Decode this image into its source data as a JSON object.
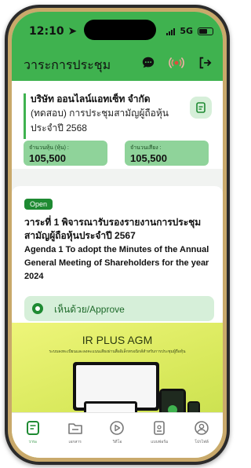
{
  "status_bar": {
    "time": "12:10",
    "network": "5G"
  },
  "header": {
    "title": "วาระการประชุม"
  },
  "company": {
    "name": "บริษัท ออนไลน์แอทเซ็ท จำกัด",
    "meeting": "(ทดสอบ) การประชุมสามัญผู้ถือหุ้นประจำปี 2568",
    "shares_label": "จำนวนหุ้น (หุ้น) :",
    "shares_value": "105,500",
    "votes_label": "จำนวนเสียง :",
    "votes_value": "105,500"
  },
  "agenda": {
    "status": "Open",
    "title_th": "วาระที่ 1 พิจารณารับรองรายงานการประชุมสามัญผู้ถือหุ้นประจำปี 2567",
    "title_en": "Agenda 1 To adopt the Minutes of the Annual General Meeting of Shareholders for the year 2024",
    "vote_option": "เห็นด้วย/Approve"
  },
  "promo": {
    "title": "IR PLUS AGM",
    "subtitle": "ระบบลงทะเบียนและลงคะแนนเสียงผ่านสื่ออิเล็กทรอนิกส์สำหรับการประชุมผู้ถือหุ้น"
  },
  "tabs": [
    {
      "label": "วาระ"
    },
    {
      "label": "เอกสาร"
    },
    {
      "label": "วิดีโอ"
    },
    {
      "label": "แบบฟอร์ม"
    },
    {
      "label": "โปรไฟล์"
    }
  ],
  "colors": {
    "brand_green": "#3fb24f",
    "dark_green": "#1e8a32",
    "light_green": "#d6efd9",
    "stat_green": "#8fd39a"
  }
}
